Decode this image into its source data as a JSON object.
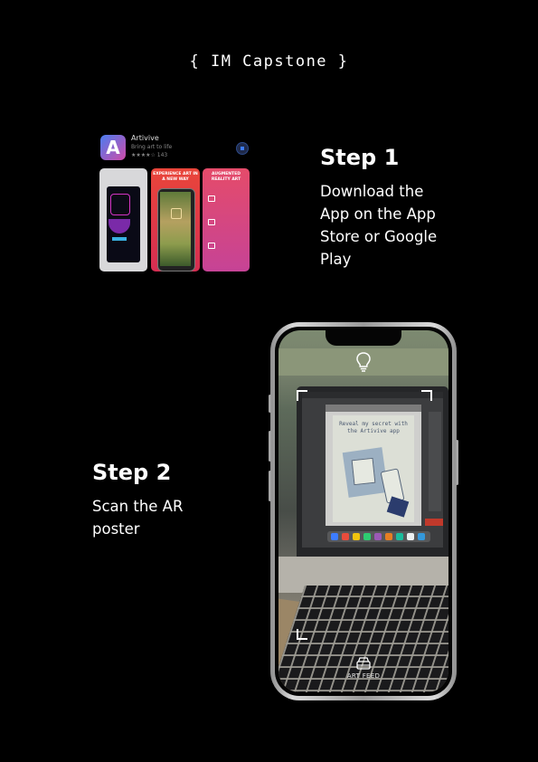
{
  "header": {
    "title": "{ IM Capstone }"
  },
  "step1": {
    "title": "Step 1",
    "description_lines": [
      "Download the",
      "App on the App",
      "Store or Google",
      "Play"
    ]
  },
  "step2": {
    "title": "Step 2",
    "description_lines": [
      "Scan the AR",
      "poster"
    ]
  },
  "app_store_listing": {
    "app_name": "Artivive",
    "subtitle": "Bring art to life",
    "rating_text": "★★★★☆ 143",
    "screenshot_captions": [
      "EXPERIENCE ART IN A NEW WAY",
      "AUGMENTED REALITY ART"
    ],
    "icon": "artivive-app-icon",
    "accent": "#3d7cff"
  },
  "phone_screen": {
    "poster_text": "Reveal my secret with the Artivive app",
    "flashlight_icon": "lightbulb-icon",
    "bottom_tab_icon": "art-feed-icon",
    "bottom_tab_label": "ART FEED"
  }
}
